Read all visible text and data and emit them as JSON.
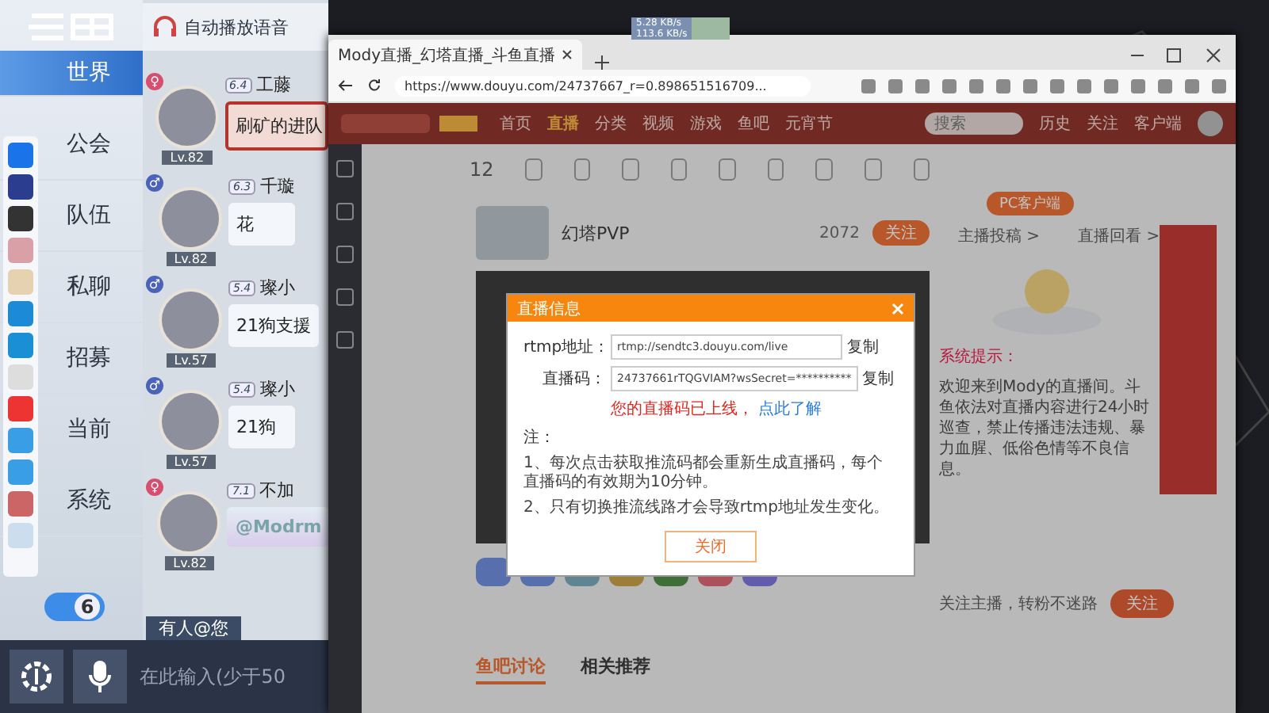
{
  "game": {
    "nav": [
      {
        "label": "世界",
        "selected": true
      },
      {
        "label": "公会",
        "selected": false
      },
      {
        "label": "队伍",
        "selected": false
      },
      {
        "label": "私聊",
        "selected": false
      },
      {
        "label": "招募",
        "selected": false
      },
      {
        "label": "当前",
        "selected": false
      },
      {
        "label": "系统",
        "selected": false
      }
    ],
    "voice_toggle": {
      "label": "自动播放语音"
    },
    "counter": {
      "value": "6",
      "on": true
    },
    "messages": [
      {
        "gender": "♀",
        "color": "#d4506e",
        "level": "Lv.82",
        "badge": "6.4",
        "name": "工藤",
        "text": "刷矿的进队",
        "kind": "highlight"
      },
      {
        "gender": "♂",
        "color": "#4a63b8",
        "level": "Lv.82",
        "badge": "6.3",
        "name": "千璇",
        "text": "花",
        "kind": "plain"
      },
      {
        "gender": "♂",
        "color": "#4a63b8",
        "level": "Lv.57",
        "badge": "5.4",
        "name": "璨小",
        "text": "21狗支援",
        "kind": "plain"
      },
      {
        "gender": "♂",
        "color": "#4a63b8",
        "level": "Lv.57",
        "badge": "5.4",
        "name": "璨小",
        "text": "21狗",
        "kind": "plain"
      },
      {
        "gender": "♀",
        "color": "#d4506e",
        "level": "Lv.82",
        "badge": "7.1",
        "name": "不加",
        "text": "@Modrm",
        "kind": "mention"
      }
    ],
    "mention_notice": "有人@您",
    "input": {
      "placeholder": "在此输入(少于50"
    }
  },
  "net_monitor": {
    "upload": "5.28 KB/s",
    "download": "113.6 KB/s"
  },
  "browser": {
    "tab": {
      "title": "Mody直播_幻塔直播_斗鱼直播"
    },
    "url": "https://www.douyu.com/24737667_r=0.898651516709...",
    "site": {
      "nav": [
        {
          "label": "首页",
          "selected": false
        },
        {
          "label": "直播",
          "selected": true
        },
        {
          "label": "分类",
          "selected": false
        },
        {
          "label": "视频",
          "selected": false
        },
        {
          "label": "游戏",
          "selected": false
        },
        {
          "label": "鱼吧",
          "selected": false
        },
        {
          "label": "元宵节",
          "selected": false
        }
      ],
      "search": {
        "placeholder": "搜索"
      },
      "user_links": [
        "历史",
        "关注",
        "客户端"
      ],
      "pc_button": "PC客户端",
      "room": {
        "count": "12",
        "title": "幻塔PVP",
        "follow_count": "2072",
        "follow_button": "关注"
      },
      "dialog": {
        "title": "直播信息",
        "fields": [
          {
            "label": "rtmp地址：",
            "value": "rtmp://sendtc3.douyu.com/live",
            "action": "复制"
          },
          {
            "label": "直播码：",
            "value": "24737661rTQGVIAM?wsSecret=**********",
            "action": "复制"
          }
        ],
        "status": "您的直播码已上线，",
        "link": "点此了解",
        "note_title": "注：",
        "notes": [
          "1、每次点击获取推流码都会重新生成直播码，每个直播码的有效期为10分钟。",
          "2、只有切换推流线路才会导致rtmp地址发生变化。"
        ],
        "close_button": "关闭"
      },
      "side": {
        "links": [
          "主播投稿 >",
          "直播回看 >"
        ],
        "notice_label": "系统提示：",
        "notice": "欢迎来到Mody的直播间。斗鱼依法对直播内容进行24小时巡查，禁止传播违法违规、暴力血腥、低俗色情等不良信息。",
        "follow_prompt": "关注主播，转粉不迷路",
        "follow_button": "关注"
      },
      "bottom_tabs": [
        {
          "label": "鱼吧讨论",
          "selected": true
        },
        {
          "label": "相关推荐",
          "selected": false
        }
      ]
    }
  }
}
